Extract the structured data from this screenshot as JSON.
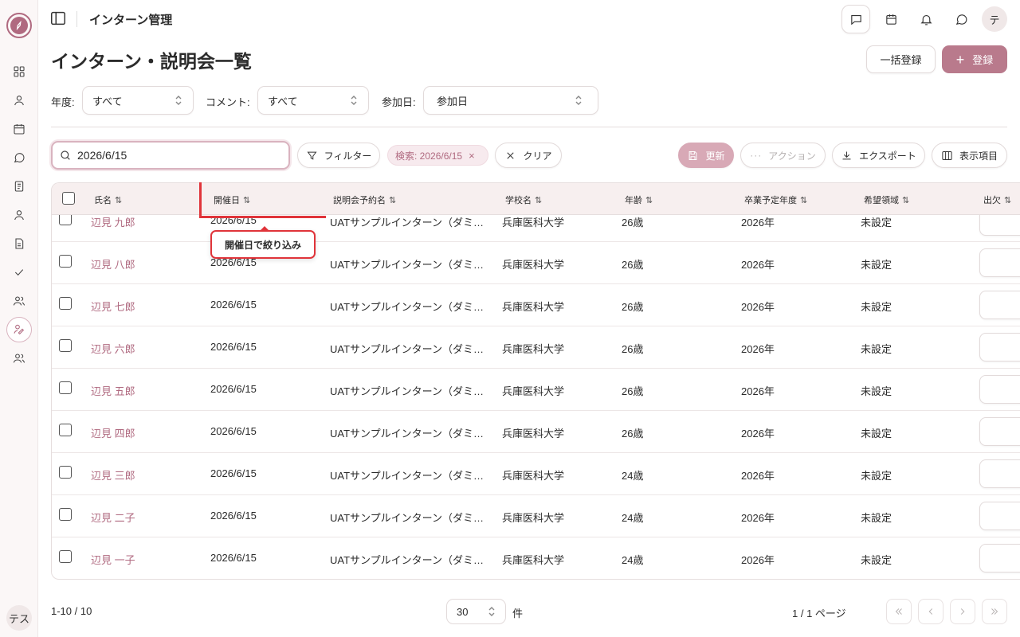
{
  "app": {
    "title": "インターン管理"
  },
  "sidebar": {
    "icons": [
      "grid-icon",
      "user-icon",
      "calendar-icon",
      "chat-icon",
      "notebook-icon",
      "user-icon",
      "document-icon",
      "check-icon",
      "users-icon",
      "intern-icon",
      "group-icon"
    ],
    "avatar": "テス"
  },
  "topbar": {
    "avatar": "テ",
    "icons": [
      "comment-icon",
      "calendar-icon",
      "bell-icon",
      "chat-icon"
    ]
  },
  "page": {
    "title": "インターン・説明会一覧"
  },
  "header": {
    "bulk_label": "一括登録",
    "register_label": "登録"
  },
  "filters": {
    "year_label": "年度:",
    "year_value": "すべて",
    "comment_label": "コメント:",
    "comment_value": "すべて",
    "joined_label": "参加日:",
    "joined_value": "参加日"
  },
  "toolbar": {
    "search_value": "2026/6/15",
    "filter_label": "フィルター",
    "chip_label": "検索: 2026/6/15",
    "clear_label": "クリア",
    "update_label": "更新",
    "action_label": "アクション",
    "export_label": "エクスポート",
    "columns_label": "表示項目"
  },
  "table": {
    "headers": [
      "氏名",
      "開催日",
      "説明会予約名",
      "学校名",
      "年齢",
      "卒業予定年度",
      "希望領域",
      "出欠"
    ],
    "rows": [
      {
        "name": "辺見 九郎",
        "date": "2026/6/15",
        "event": "UATサンプルインターン（ダミー）",
        "school": "兵庫医科大学",
        "age": "26歳",
        "grad": "2026年",
        "area": "未設定"
      },
      {
        "name": "辺見 八郎",
        "date": "2026/6/15",
        "event": "UATサンプルインターン（ダミー）",
        "school": "兵庫医科大学",
        "age": "26歳",
        "grad": "2026年",
        "area": "未設定"
      },
      {
        "name": "辺見 七郎",
        "date": "2026/6/15",
        "event": "UATサンプルインターン（ダミー）",
        "school": "兵庫医科大学",
        "age": "26歳",
        "grad": "2026年",
        "area": "未設定"
      },
      {
        "name": "辺見 六郎",
        "date": "2026/6/15",
        "event": "UATサンプルインターン（ダミー）",
        "school": "兵庫医科大学",
        "age": "26歳",
        "grad": "2026年",
        "area": "未設定"
      },
      {
        "name": "辺見 五郎",
        "date": "2026/6/15",
        "event": "UATサンプルインターン（ダミー）",
        "school": "兵庫医科大学",
        "age": "26歳",
        "grad": "2026年",
        "area": "未設定"
      },
      {
        "name": "辺見 四郎",
        "date": "2026/6/15",
        "event": "UATサンプルインターン（ダミー）",
        "school": "兵庫医科大学",
        "age": "26歳",
        "grad": "2026年",
        "area": "未設定"
      },
      {
        "name": "辺見 三郎",
        "date": "2026/6/15",
        "event": "UATサンプルインターン（ダミー）",
        "school": "兵庫医科大学",
        "age": "24歳",
        "grad": "2026年",
        "area": "未設定"
      },
      {
        "name": "辺見 二子",
        "date": "2026/6/15",
        "event": "UATサンプルインターン（ダミー）",
        "school": "兵庫医科大学",
        "age": "24歳",
        "grad": "2026年",
        "area": "未設定"
      },
      {
        "name": "辺見 一子",
        "date": "2026/6/15",
        "event": "UATサンプルインターン（ダミー）",
        "school": "兵庫医科大学",
        "age": "24歳",
        "grad": "2026年",
        "area": "未設定"
      }
    ]
  },
  "tooltip": {
    "text": "開催日で絞り込み"
  },
  "footer": {
    "count": "1-10 / 10",
    "per_page": "30",
    "per_page_unit": "件",
    "page_info": "1 / 1 ページ"
  },
  "colors": {
    "accent": "#b06a80",
    "primary_button": "#b97a8c",
    "highlight": "#e0343a"
  }
}
